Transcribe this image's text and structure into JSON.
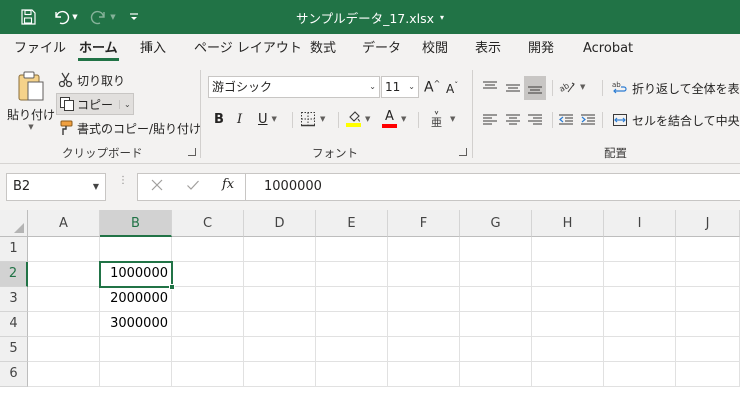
{
  "titlebar": {
    "filename": "サンプルデータ_17.xlsx",
    "caret": "▾"
  },
  "menu": {
    "tabs": [
      "ファイル",
      "ホーム",
      "挿入",
      "ページ レイアウト",
      "数式",
      "データ",
      "校閲",
      "表示",
      "開発",
      "Acrobat"
    ],
    "active_index": 1
  },
  "ribbon": {
    "clipboard": {
      "paste_label": "貼り付け",
      "cut_label": "切り取り",
      "copy_label": "コピー",
      "format_painter_label": "書式のコピー/貼り付け",
      "group_label": "クリップボード"
    },
    "font": {
      "font_name": "游ゴシック",
      "font_size": "11",
      "bold": "B",
      "italic": "I",
      "underline": "U",
      "font_color_letter": "A",
      "group_label": "フォント",
      "highlight_color": "#ffff00",
      "font_color": "#ff0000"
    },
    "alignment": {
      "wrap_text_label": "折り返して全体を表示す",
      "merge_center_label": "セルを結合して中央揃え",
      "group_label": "配置"
    }
  },
  "formula_bar": {
    "name_box": "B2",
    "fx_label": "fx",
    "formula": "1000000"
  },
  "sheet": {
    "columns": [
      "A",
      "B",
      "C",
      "D",
      "E",
      "F",
      "G",
      "H",
      "I",
      "J"
    ],
    "rows": [
      "1",
      "2",
      "3",
      "4",
      "5",
      "6"
    ],
    "selected_column": "B",
    "selected_row": "2",
    "cells": {
      "B2": "1000000",
      "B3": "2000000",
      "B4": "3000000"
    }
  },
  "colors": {
    "accent": "#217346",
    "ribbon_bg": "#f3f2f1"
  }
}
